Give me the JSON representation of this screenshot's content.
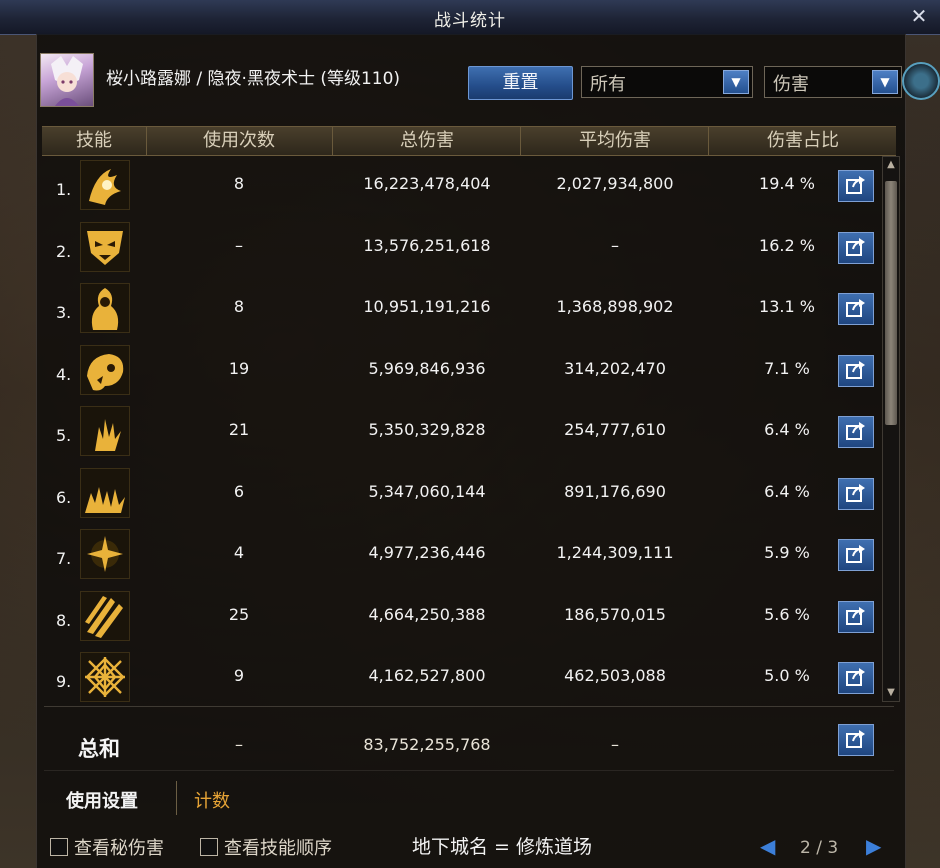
{
  "window": {
    "title": "战斗统计",
    "close_label": "✕"
  },
  "character": {
    "info": "桜小路露娜 / 隐夜·黑夜术士 (等级110)"
  },
  "toolbar": {
    "reset_label": "重置",
    "filter_value": "所有",
    "metric_value": "伤害",
    "dropdown_arrow": "▼"
  },
  "table": {
    "headers": [
      "技能",
      "使用次数",
      "总伤害",
      "平均伤害",
      "伤害占比"
    ],
    "rows": [
      {
        "rank": "1.",
        "uses": "8",
        "total": "16,223,478,404",
        "avg": "2,027,934,800",
        "pct": "19.4 %",
        "icon": "flame-claw-icon"
      },
      {
        "rank": "2.",
        "uses": "–",
        "total": "13,576,251,618",
        "avg": "–",
        "pct": "16.2 %",
        "icon": "demon-mask-icon"
      },
      {
        "rank": "3.",
        "uses": "8",
        "total": "10,951,191,216",
        "avg": "1,368,898,902",
        "pct": "13.1 %",
        "icon": "witch-figure-icon"
      },
      {
        "rank": "4.",
        "uses": "19",
        "total": "5,969,846,936",
        "avg": "314,202,470",
        "pct": "7.1 %",
        "icon": "skull-beast-icon"
      },
      {
        "rank": "5.",
        "uses": "21",
        "total": "5,350,329,828",
        "avg": "254,777,610",
        "pct": "6.4 %",
        "icon": "golden-hand-icon"
      },
      {
        "rank": "6.",
        "uses": "6",
        "total": "5,347,060,144",
        "avg": "891,176,690",
        "pct": "6.4 %",
        "icon": "many-hands-icon"
      },
      {
        "rank": "7.",
        "uses": "4",
        "total": "4,977,236,446",
        "avg": "1,244,309,111",
        "pct": "5.9 %",
        "icon": "dark-burst-icon"
      },
      {
        "rank": "8.",
        "uses": "25",
        "total": "4,664,250,388",
        "avg": "186,570,015",
        "pct": "5.6 %",
        "icon": "claw-slash-icon"
      },
      {
        "rank": "9.",
        "uses": "9",
        "total": "4,162,527,800",
        "avg": "462,503,088",
        "pct": "5.0 %",
        "icon": "spider-web-icon"
      }
    ],
    "total": {
      "label": "总和",
      "uses": "–",
      "total": "83,752,255,768",
      "avg": "–"
    }
  },
  "tabs": {
    "settings": "使用设置",
    "count": "计数"
  },
  "footer": {
    "check_secret": "查看秘伤害",
    "check_order": "查看技能顺序",
    "dungeon": "地下城名 = 修炼道场",
    "page": "2 / 3",
    "prev": "◀",
    "next": "▶"
  },
  "colors": {
    "accent_blue": "#2c5da0",
    "gold": "#e7a436",
    "icon_gold": "#e9b23a"
  }
}
